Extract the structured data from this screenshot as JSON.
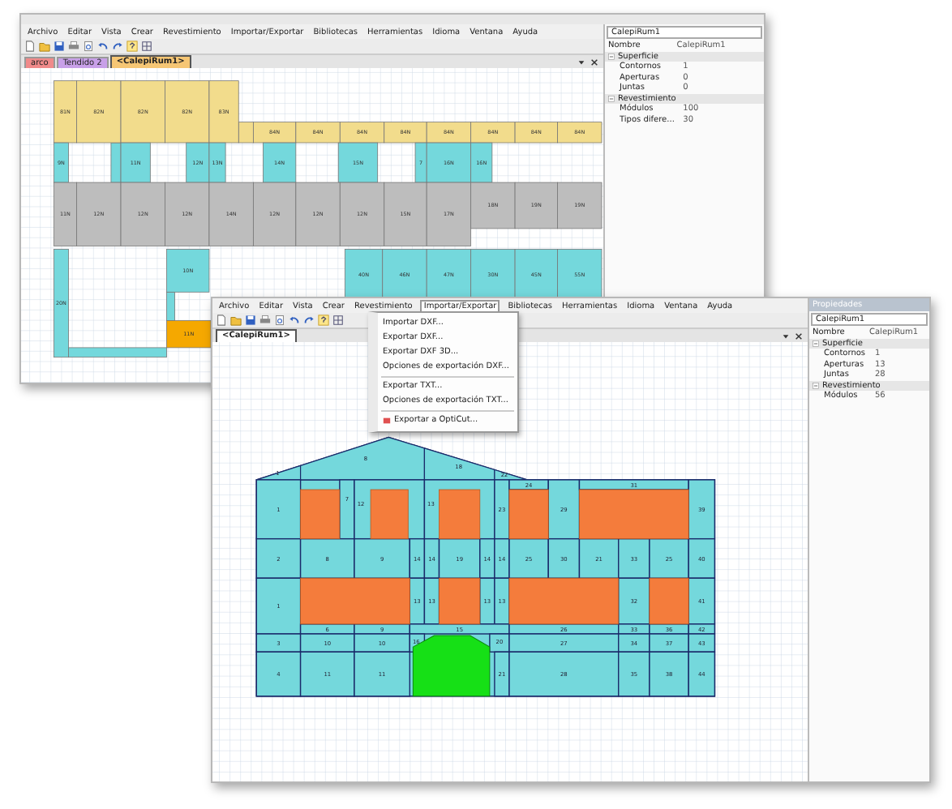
{
  "back_window": {
    "menu": [
      "Archivo",
      "Editar",
      "Vista",
      "Crear",
      "Revestimiento",
      "Importar/Exportar",
      "Bibliotecas",
      "Herramientas",
      "Idioma",
      "Ventana",
      "Ayuda"
    ],
    "tabs": [
      {
        "label": "arco",
        "selected": false,
        "color": "#f08a8a"
      },
      {
        "label": "Tendido 2",
        "selected": false,
        "color": "#c8a0e8"
      },
      {
        "label": "<CalepiRum1>",
        "selected": true,
        "color": "#f6c674"
      }
    ],
    "tiles": [
      {
        "label": "81N",
        "color": "#f2dc8c"
      },
      {
        "label": "82N",
        "color": "#f2dc8c"
      },
      {
        "label": "82N",
        "color": "#f2dc8c"
      },
      {
        "label": "82N",
        "color": "#f2dc8c"
      },
      {
        "label": "83N",
        "color": "#f2dc8c"
      },
      {
        "label": "84N",
        "color": "#f2dc8c"
      },
      {
        "label": "84N",
        "color": "#f2dc8c"
      },
      {
        "label": "84N",
        "color": "#f2dc8c"
      },
      {
        "label": "84N",
        "color": "#f2dc8c"
      },
      {
        "label": "84N",
        "color": "#f2dc8c"
      },
      {
        "label": "84N",
        "color": "#f2dc8c"
      },
      {
        "label": "84N",
        "color": "#f2dc8c"
      },
      {
        "label": "84N",
        "color": "#f2dc8c"
      },
      {
        "label": "9N",
        "color": "#74d8dc"
      },
      {
        "label": "11N",
        "color": "#74d8dc"
      },
      {
        "label": "12N",
        "color": "#74d8dc"
      },
      {
        "label": "13N",
        "color": "#74d8dc"
      },
      {
        "label": "14N",
        "color": "#74d8dc"
      },
      {
        "label": "15N",
        "color": "#74d8dc"
      },
      {
        "label": "7",
        "color": "#74d8dc"
      },
      {
        "label": "16N",
        "color": "#74d8dc"
      },
      {
        "label": "16N",
        "color": "#74d8dc"
      },
      {
        "label": "11N",
        "color": "#bdbdbd"
      },
      {
        "label": "12N",
        "color": "#bdbdbd"
      },
      {
        "label": "12N",
        "color": "#bdbdbd"
      },
      {
        "label": "12N",
        "color": "#bdbdbd"
      },
      {
        "label": "14N",
        "color": "#bdbdbd"
      },
      {
        "label": "12N",
        "color": "#bdbdbd"
      },
      {
        "label": "12N",
        "color": "#bdbdbd"
      },
      {
        "label": "12N",
        "color": "#bdbdbd"
      },
      {
        "label": "15N",
        "color": "#bdbdbd"
      },
      {
        "label": "17N",
        "color": "#bdbdbd"
      },
      {
        "label": "18N",
        "color": "#bdbdbd"
      },
      {
        "label": "19N",
        "color": "#bdbdbd"
      },
      {
        "label": "19N",
        "color": "#bdbdbd"
      },
      {
        "label": "20N",
        "color": "#74d8dc"
      },
      {
        "label": "10N",
        "color": "#74d8dc"
      },
      {
        "label": "40N",
        "color": "#74d8dc"
      },
      {
        "label": "46N",
        "color": "#74d8dc"
      },
      {
        "label": "47N",
        "color": "#74d8dc"
      },
      {
        "label": "30N",
        "color": "#74d8dc"
      },
      {
        "label": "45N",
        "color": "#74d8dc"
      },
      {
        "label": "55N",
        "color": "#74d8dc"
      },
      {
        "label": "11N",
        "color": "#f5a800"
      }
    ],
    "properties": {
      "object": "CalepiRum1",
      "name_label": "Nombre",
      "name_value": "CalepiRum1",
      "sections": [
        {
          "title": "Superficie",
          "expanded": true,
          "rows": [
            {
              "label": "Contornos",
              "value": "1"
            },
            {
              "label": "Aperturas",
              "value": "0"
            },
            {
              "label": "Juntas",
              "value": "0"
            }
          ]
        },
        {
          "title": "Revestimiento",
          "expanded": true,
          "rows": [
            {
              "label": "Módulos",
              "value": "100"
            },
            {
              "label": "Tipos difere...",
              "value": "30"
            }
          ]
        }
      ]
    }
  },
  "front_window": {
    "menu": [
      {
        "label": "Archivo",
        "open": false
      },
      {
        "label": "Editar",
        "open": false
      },
      {
        "label": "Vista",
        "open": false
      },
      {
        "label": "Crear",
        "open": false
      },
      {
        "label": "Revestimiento",
        "open": false
      },
      {
        "label": "Importar/Exportar",
        "open": true
      },
      {
        "label": "Bibliotecas",
        "open": false
      },
      {
        "label": "Herramientas",
        "open": false
      },
      {
        "label": "Idioma",
        "open": false
      },
      {
        "label": "Ventana",
        "open": false
      },
      {
        "label": "Ayuda",
        "open": false
      }
    ],
    "menu_groups": [
      [
        "Importar DXF...",
        "Exportar DXF...",
        "Exportar DXF 3D...",
        "Opciones de exportación DXF..."
      ],
      [
        "Exportar TXT...",
        "Opciones de exportación TXT..."
      ],
      [
        "Exportar a OptiCut..."
      ]
    ],
    "tabs": [
      {
        "label": "<CalepiRum1>",
        "selected": true
      }
    ],
    "tiles": [
      "1",
      "8",
      "18",
      "22",
      "1",
      "7",
      "12",
      "13",
      "23",
      "24",
      "29",
      "31",
      "39",
      "2",
      "8",
      "9",
      "14",
      "14",
      "19",
      "14",
      "14",
      "25",
      "30",
      "21",
      "33",
      "25",
      "40",
      "1",
      "13",
      "13",
      "13",
      "13",
      "32",
      "41",
      "6",
      "9",
      "15",
      "26",
      "33",
      "36",
      "42",
      "3",
      "10",
      "10",
      "16",
      "20",
      "27",
      "34",
      "37",
      "43",
      "4",
      "11",
      "11",
      "21",
      "28",
      "35",
      "38",
      "44"
    ],
    "openings": [
      {
        "kind": "window"
      },
      {
        "kind": "window"
      },
      {
        "kind": "window"
      },
      {
        "kind": "window"
      },
      {
        "kind": "window"
      },
      {
        "kind": "window"
      },
      {
        "kind": "window"
      },
      {
        "kind": "window"
      },
      {
        "kind": "window"
      },
      {
        "kind": "door"
      }
    ],
    "properties": {
      "title": "Propiedades",
      "object": "CalepiRum1",
      "name_label": "Nombre",
      "name_value": "CalepiRum1",
      "sections": [
        {
          "title": "Superficie",
          "expanded": true,
          "rows": [
            {
              "label": "Contornos",
              "value": "1"
            },
            {
              "label": "Aperturas",
              "value": "13"
            },
            {
              "label": "Juntas",
              "value": "28"
            }
          ]
        },
        {
          "title": "Revestimiento",
          "expanded": true,
          "rows": [
            {
              "label": "Módulos",
              "value": "56"
            }
          ]
        }
      ]
    }
  }
}
